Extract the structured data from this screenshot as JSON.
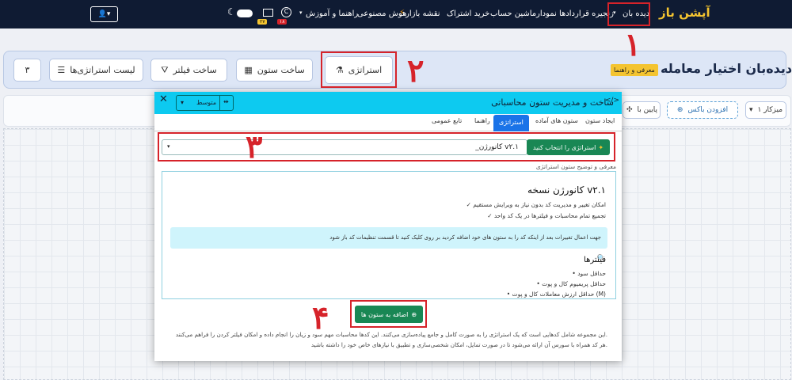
{
  "nav": {
    "brand": "آپشن باز",
    "items": [
      "دیده بان",
      "زنجیره قراردادها",
      "نمودار",
      "ماشین حساب",
      "خرید اشتراک",
      "نقشه بازار",
      "هوش مصنوعی",
      "راهنما و آموزش"
    ],
    "badge_a": "۲۷",
    "badge_b": "۱۸"
  },
  "annotations": [
    "۱",
    "۲",
    "۳",
    "۴"
  ],
  "page": {
    "title": "دیده‌بان اختیار معامله",
    "intro_badge": "معرفی و راهنما"
  },
  "toolbar": {
    "strategy": "استراتژی",
    "build_column": "ساخت ستون",
    "build_filter": "ساخت فیلتر",
    "strategy_list": "لیست استراتژی‌ها",
    "count": "۳"
  },
  "strip": {
    "zoom": "میزکار ۱",
    "add_box": "افزودن باکس",
    "bottom_partial": "پایین با"
  },
  "modal": {
    "title": "ساخت و مدیریت ستون محاسباتی",
    "size_option": "متوسط",
    "tabs": [
      "ایجاد ستون",
      "ستون های آماده",
      "استراتژی",
      "راهنما",
      "تابع عمومی"
    ],
    "active_tab": "استراتژی",
    "select_value": "_کانورژن v۲.۱",
    "select_button": "استراتژی را انتخاب کنید",
    "section_label": "معرفی و توضیح ستون استراتژی",
    "desc": {
      "heading": "کانورژن نسخه v۲.۱",
      "line1": "✓ امکان تغییر و مدیریت کد بدون نیاز به ویرایش مستقیم",
      "line2": "✓ تجمیع تمام محاسبات و فیلترها در یک کد واحد",
      "note": "جهت اعمال تغییرات بعد از اینکه کد را به ستون های خود اضافه کردید بر روی  کلیک کنید تا قسمت تنظیمات کد باز شود",
      "filters_heading": "فیلترها",
      "f1": "• حداقل سود",
      "f2": "• حداقل پریمیوم کال و پوت",
      "f3": "• حداقل ارزش معاملات کال و پوت (M)"
    },
    "add_button": "اضافه به ستون ها",
    "footer1": "این مجموعه شامل کدهایی است که یک استراتژی را به صورت کامل و جامع پیاده‌سازی می‌کنند. این کدها محاسبات مهم سود و زیان را انجام داده و امکان فیلتر کردن را فراهم می‌کنند.",
    "footer2": "هر کد همراه با سورس آن ارائه می‌شود تا در صورت تمایل، امکان شخصی‌سازی و تطبیق با نیازهای خاص خود را داشته باشید."
  },
  "colors": {
    "navbar": "#0f1b33",
    "accent_red": "#d6232a",
    "primary": "#1a73e8",
    "success": "#198754",
    "info": "#0dcaf0"
  }
}
